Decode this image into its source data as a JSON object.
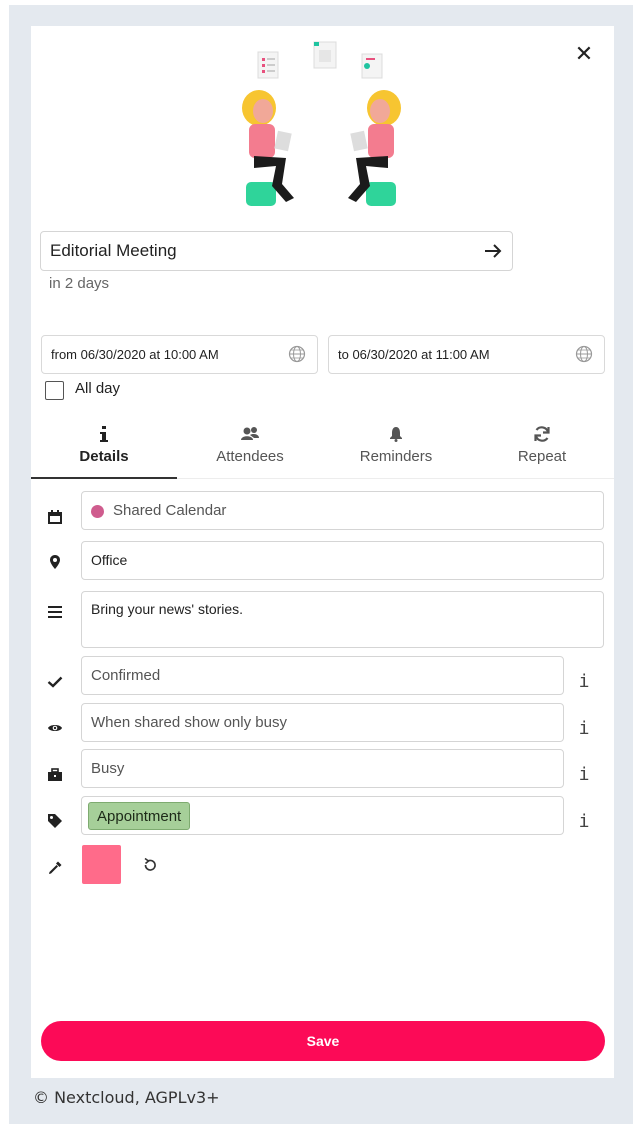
{
  "event": {
    "title": "Editorial Meeting",
    "relative_time": "in 2 days",
    "from": "from 06/30/2020 at 10:00 AM",
    "to": "to 06/30/2020 at 11:00 AM",
    "all_day_label": "All day",
    "all_day_checked": false
  },
  "tabs": [
    {
      "label": "Details",
      "icon": "info-icon",
      "active": true
    },
    {
      "label": "Attendees",
      "icon": "people-icon",
      "active": false
    },
    {
      "label": "Reminders",
      "icon": "bell-icon",
      "active": false
    },
    {
      "label": "Repeat",
      "icon": "repeat-icon",
      "active": false
    }
  ],
  "details": {
    "calendar": {
      "value": "Shared Calendar",
      "color": "#cf5c8e",
      "icon": "calendar-icon"
    },
    "location": {
      "value": "Office",
      "icon": "location-pin-icon"
    },
    "description": {
      "value": "Bring your news' stories.",
      "icon": "description-icon"
    },
    "status": {
      "value": "Confirmed",
      "icon": "check-icon"
    },
    "visibility": {
      "value": "When shared show only busy",
      "icon": "eye-icon"
    },
    "availability": {
      "value": "Busy",
      "icon": "briefcase-icon"
    },
    "categories": {
      "value": "Appointment",
      "chip_color": "#a6cf99",
      "icon": "tag-icon"
    },
    "color": {
      "value": "#ff6b8a",
      "icon": "eyedropper-icon"
    },
    "info_glyph": "i"
  },
  "actions": {
    "close_glyph": "✕",
    "save_label": "Save"
  },
  "footer": {
    "copyright": "© Nextcloud, AGPLv3+"
  },
  "colors": {
    "accent": "#fc0a57",
    "background": "#e4e9ef",
    "panel": "#ffffff"
  }
}
